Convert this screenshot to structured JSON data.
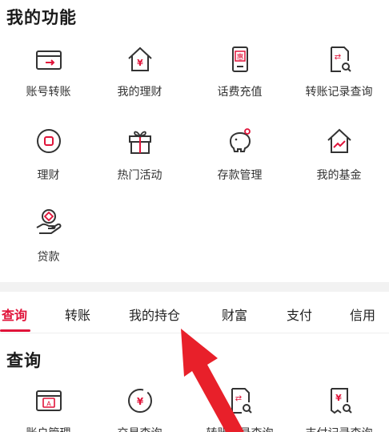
{
  "section1": {
    "title": "我的功能",
    "items": [
      {
        "label": "账号转账",
        "icon": "transfer-card-icon"
      },
      {
        "label": "我的理财",
        "icon": "house-yuan-icon"
      },
      {
        "label": "话费充值",
        "icon": "phone-recharge-icon"
      },
      {
        "label": "转账记录查询",
        "icon": "transfer-record-icon"
      },
      {
        "label": "理财",
        "icon": "circle-square-icon"
      },
      {
        "label": "热门活动",
        "icon": "gift-icon"
      },
      {
        "label": "存款管理",
        "icon": "piggy-bank-icon"
      },
      {
        "label": "我的基金",
        "icon": "house-chart-icon"
      },
      {
        "label": "贷款",
        "icon": "hand-coin-icon"
      }
    ]
  },
  "tabs": [
    {
      "label": "查询",
      "active": true
    },
    {
      "label": "转账",
      "active": false
    },
    {
      "label": "我的持仓",
      "active": false
    },
    {
      "label": "财富",
      "active": false
    },
    {
      "label": "支付",
      "active": false
    },
    {
      "label": "信用",
      "active": false
    }
  ],
  "section2": {
    "title": "查询",
    "items": [
      {
        "label": "账户管理",
        "icon": "account-card-icon"
      },
      {
        "label": "交易查询",
        "icon": "yuan-circle-icon"
      },
      {
        "label": "转账记录查询",
        "icon": "transfer-record-icon"
      },
      {
        "label": "支付记录查询",
        "icon": "payment-record-icon"
      }
    ]
  },
  "colors": {
    "accent": "#e0143a",
    "text": "#333333",
    "divider": "#f2f2f2",
    "arrow": "#e8202a"
  }
}
